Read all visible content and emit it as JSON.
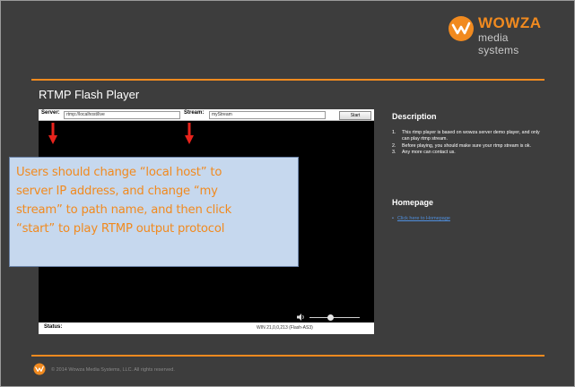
{
  "colors": {
    "accent": "#f18a1f",
    "background": "#3d3d3d",
    "link": "#4f8fde",
    "arrow": "#e8231c"
  },
  "brand": {
    "name": "WOWZA",
    "tagline": "media systems"
  },
  "page": {
    "title": "RTMP Flash Player"
  },
  "player": {
    "server_label": "Server:",
    "server_value": "rtmp://localhost/live",
    "stream_label": "Stream:",
    "stream_value": "myStream",
    "start_label": "Start",
    "status_label": "Status:",
    "version": "WIN 21,0,0,213 (Flash-AS3)"
  },
  "annotation": {
    "lines": [
      "Users should change “local host” to",
      "server IP address, and change “my",
      "stream” to path name, and then click",
      "“start” to play RTMP output protocol"
    ]
  },
  "sidebar": {
    "description_heading": "Description",
    "items": [
      {
        "num": "1.",
        "text": "This rtmp player is based on wowza server demo player, and only can play rtmp stream."
      },
      {
        "num": "2.",
        "text": "Before playing, you should make sure your rtmp stream is ok."
      },
      {
        "num": "3.",
        "text": "Any more can contact us."
      }
    ],
    "homepage_heading": "Homepage",
    "homepage_link": "Click here to Homepage"
  },
  "footer": {
    "copyright": "© 2014 Wowza Media Systems, LLC. All rights reserved."
  },
  "icons": [
    "wowza-logo-icon",
    "red-arrow-icon",
    "volume-icon",
    "footer-logo-icon"
  ]
}
